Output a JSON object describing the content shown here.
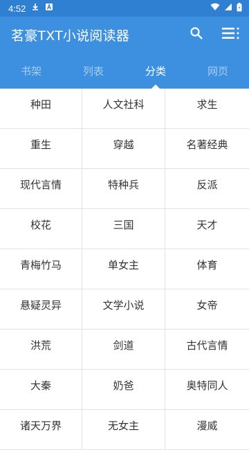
{
  "status_bar": {
    "time": "4:52",
    "icons": [
      "download-icon",
      "a-notification-icon",
      "wifi-icon",
      "signal-icon",
      "battery-icon"
    ]
  },
  "app_bar": {
    "title": "茗豪TXT小说阅读器",
    "actions": [
      "search-icon",
      "menu-list-icon"
    ]
  },
  "tabs": [
    {
      "label": "书架",
      "active": false
    },
    {
      "label": "列表",
      "active": false
    },
    {
      "label": "分类",
      "active": true
    },
    {
      "label": "网页",
      "active": false
    }
  ],
  "categories": [
    "种田",
    "人文社科",
    "求生",
    "重生",
    "穿越",
    "名著经典",
    "现代言情",
    "特种兵",
    "反派",
    "校花",
    "三国",
    "天才",
    "青梅竹马",
    "单女主",
    "体育",
    "悬疑灵异",
    "文学小说",
    "女帝",
    "洪荒",
    "剑道",
    "古代言情",
    "大秦",
    "奶爸",
    "奥特同人",
    "诸天万界",
    "无女主",
    "漫威"
  ],
  "colors": {
    "status_bar": "#2f7fd2",
    "primary": "#3d8fe0",
    "divider": "#e2e2e2",
    "text": "#333333"
  }
}
